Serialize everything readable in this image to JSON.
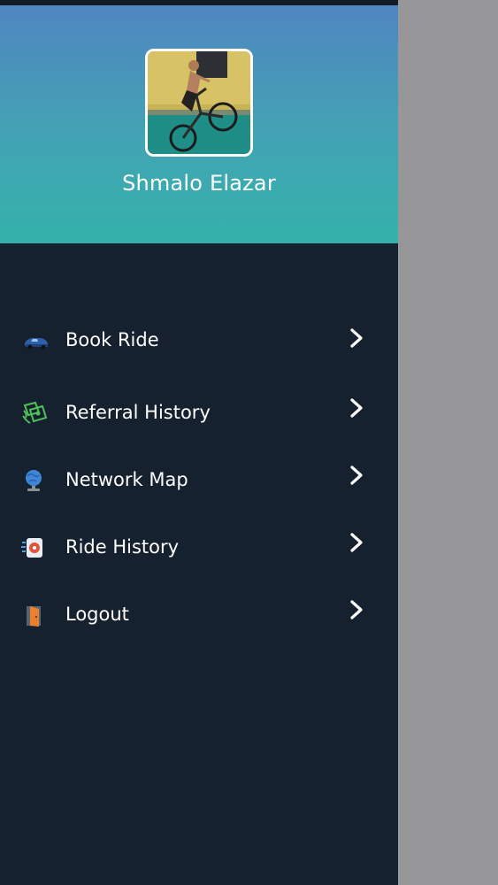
{
  "user": {
    "name": "Shmalo Elazar",
    "avatar_alt": "profile photo"
  },
  "menu": {
    "items": [
      {
        "label": "Book Ride",
        "icon": "car-icon"
      },
      {
        "label": "Referral History",
        "icon": "money-icon"
      },
      {
        "label": "Network Map",
        "icon": "globe-icon"
      },
      {
        "label": "Ride History",
        "icon": "ride-history-icon"
      },
      {
        "label": "Logout",
        "icon": "door-icon"
      }
    ]
  },
  "colors": {
    "drawer_bg": "#15212e",
    "header_gradient_top": "#4f86c0",
    "header_gradient_bottom": "#33b2aa",
    "scrim": "#97979a",
    "text": "#ffffff"
  }
}
